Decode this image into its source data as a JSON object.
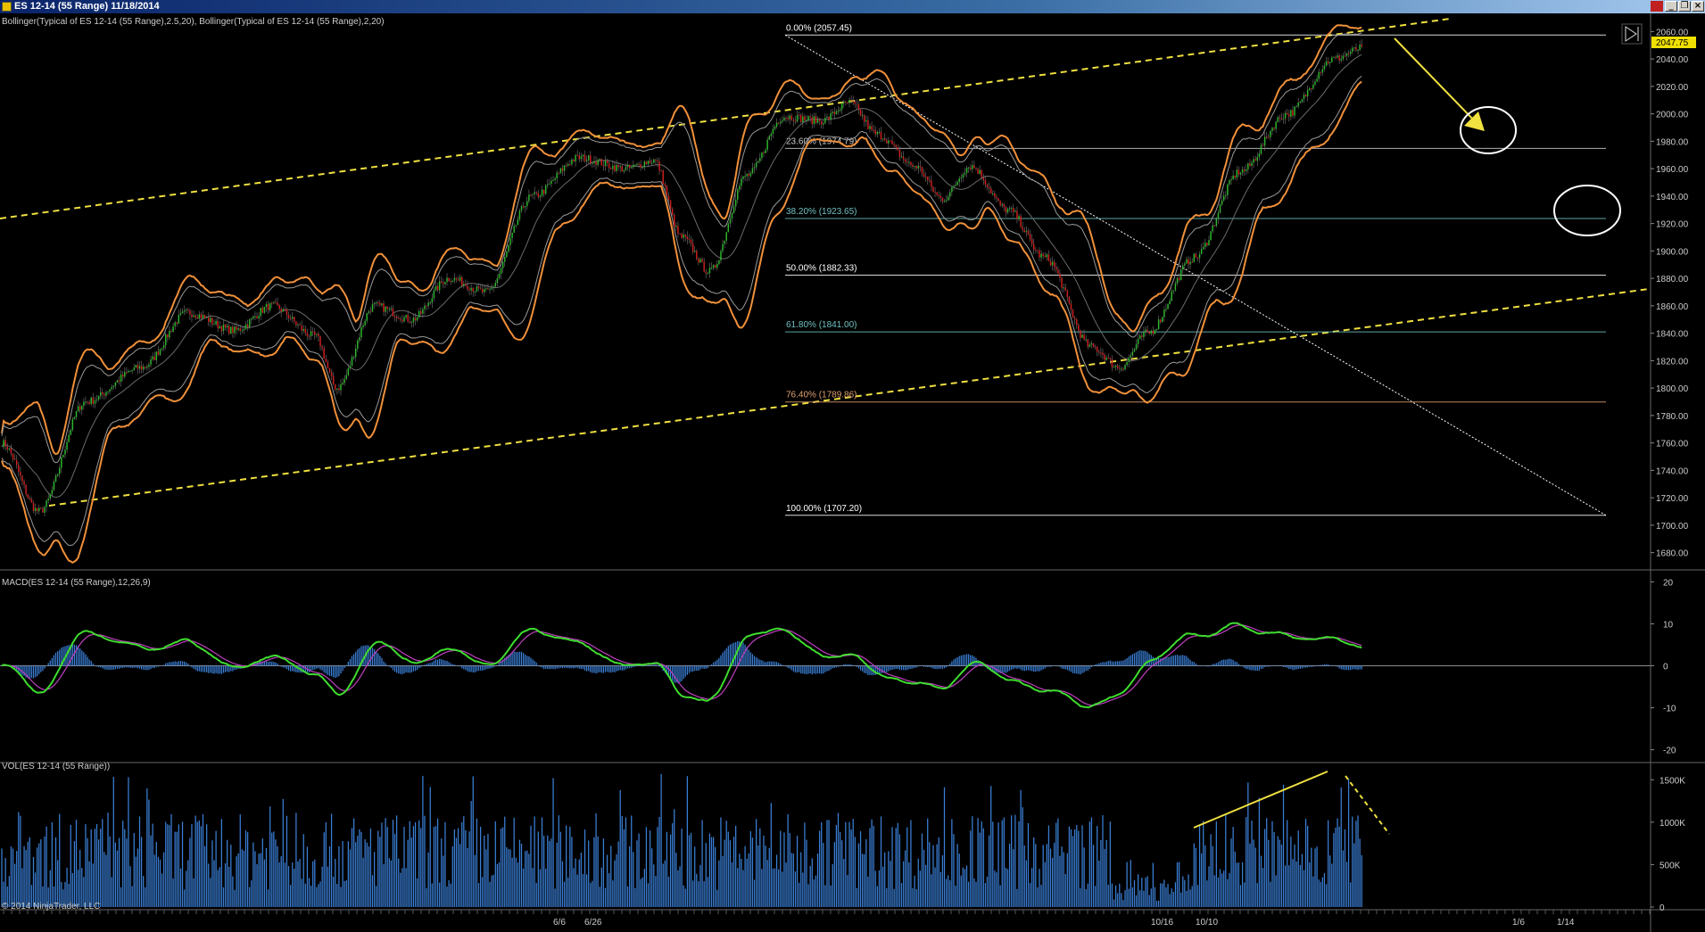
{
  "window": {
    "title": "ES 12-14 (55 Range)  11/18/2014"
  },
  "colors": {
    "background": "#000000",
    "candle_up": "#2db82d",
    "candle_down": "#d02020",
    "bollinger_outer": "#f0903a",
    "bollinger_inner": "#9a9a9a",
    "trend_line": "#f0e040",
    "macd_line": "#3fdc2f",
    "signal_line": "#c040c0",
    "histogram": "#3a7fd6",
    "volume": "#3a7fd6",
    "price_marker": "#f0e000",
    "fib_line": "#cccccc"
  },
  "panels": {
    "price": {
      "indicator_label": "Bollinger(Typical of ES 12-14 (55 Range),2.5,20),  Bollinger(Typical of ES 12-14 (55 Range),2,20)",
      "last_price": "2047.75"
    },
    "macd": {
      "indicator_label": "MACD(ES 12-14 (55 Range),12,26,9)"
    },
    "volume": {
      "indicator_label": "VOL(ES 12-14 (55 Range))"
    }
  },
  "copyright": "© 2014 NinjaTrader, LLC",
  "x_axis": {
    "visible_labels": [
      "6/6",
      "6/26",
      "10/16",
      "10/10",
      "1/6",
      "1/14"
    ]
  },
  "chart_data": [
    {
      "type": "candlestick",
      "title": "ES 12-14 (55 Range)",
      "ylim": [
        1670,
        2070
      ],
      "y_ticks": [
        1680,
        1700,
        1720,
        1740,
        1760,
        1780,
        1800,
        1820,
        1840,
        1860,
        1880,
        1900,
        1920,
        1940,
        1960,
        1980,
        2000,
        2020,
        2040,
        2060
      ],
      "grid": false,
      "price_path": [
        {
          "bar": 0,
          "close": 1760
        },
        {
          "bar": 20,
          "close": 1710
        },
        {
          "bar": 45,
          "close": 1790
        },
        {
          "bar": 75,
          "close": 1815
        },
        {
          "bar": 100,
          "close": 1855
        },
        {
          "bar": 125,
          "close": 1842
        },
        {
          "bar": 145,
          "close": 1860
        },
        {
          "bar": 168,
          "close": 1838
        },
        {
          "bar": 180,
          "close": 1800
        },
        {
          "bar": 200,
          "close": 1860
        },
        {
          "bar": 220,
          "close": 1850
        },
        {
          "bar": 240,
          "close": 1880
        },
        {
          "bar": 260,
          "close": 1870
        },
        {
          "bar": 285,
          "close": 1940
        },
        {
          "bar": 310,
          "close": 1968
        },
        {
          "bar": 335,
          "close": 1960
        },
        {
          "bar": 350,
          "close": 1966
        },
        {
          "bar": 365,
          "close": 1910
        },
        {
          "bar": 380,
          "close": 1885
        },
        {
          "bar": 400,
          "close": 1955
        },
        {
          "bar": 420,
          "close": 1998
        },
        {
          "bar": 440,
          "close": 1995
        },
        {
          "bar": 455,
          "close": 2008
        },
        {
          "bar": 470,
          "close": 1985
        },
        {
          "bar": 490,
          "close": 1962
        },
        {
          "bar": 505,
          "close": 1938
        },
        {
          "bar": 520,
          "close": 1962
        },
        {
          "bar": 540,
          "close": 1930
        },
        {
          "bar": 560,
          "close": 1895
        },
        {
          "bar": 585,
          "close": 1830
        },
        {
          "bar": 600,
          "close": 1815
        },
        {
          "bar": 615,
          "close": 1840
        },
        {
          "bar": 640,
          "close": 1895
        },
        {
          "bar": 665,
          "close": 1958
        },
        {
          "bar": 690,
          "close": 2000
        },
        {
          "bar": 715,
          "close": 2040
        },
        {
          "bar": 730,
          "close": 2047.75
        }
      ],
      "fibonacci": {
        "high": 2057.45,
        "low": 1707.2,
        "levels": [
          {
            "label": "0.00% (2057.45)",
            "price": 2057.45,
            "color": "#ffffff"
          },
          {
            "label": "23.60% (1974.79)",
            "price": 1974.79,
            "color": "#cccccc"
          },
          {
            "label": "38.20% (1923.65)",
            "price": 1923.65,
            "color": "#70c0c0"
          },
          {
            "label": "50.00% (1882.33)",
            "price": 1882.33,
            "color": "#ffffff"
          },
          {
            "label": "61.80% (1841.00)",
            "price": 1841.0,
            "color": "#70c0c0"
          },
          {
            "label": "76.40% (1789.86)",
            "price": 1789.86,
            "color": "#e0a070"
          },
          {
            "label": "100.00% (1707.20)",
            "price": 1707.2,
            "color": "#ffffff"
          }
        ]
      },
      "last_price": 2047.75
    },
    {
      "type": "line",
      "title": "MACD(ES 12-14 (55 Range),12,26,9)",
      "ylim": [
        -22,
        22
      ],
      "y_ticks": [
        -20,
        -10,
        0,
        10,
        20
      ]
    },
    {
      "type": "bar",
      "title": "VOL(ES 12-14 (55 Range))",
      "ylim": [
        0,
        1650
      ],
      "y_ticks": [
        0,
        500,
        1000,
        1500
      ],
      "y_tick_labels": [
        "0",
        "500K",
        "1000K",
        "1500K"
      ]
    }
  ]
}
